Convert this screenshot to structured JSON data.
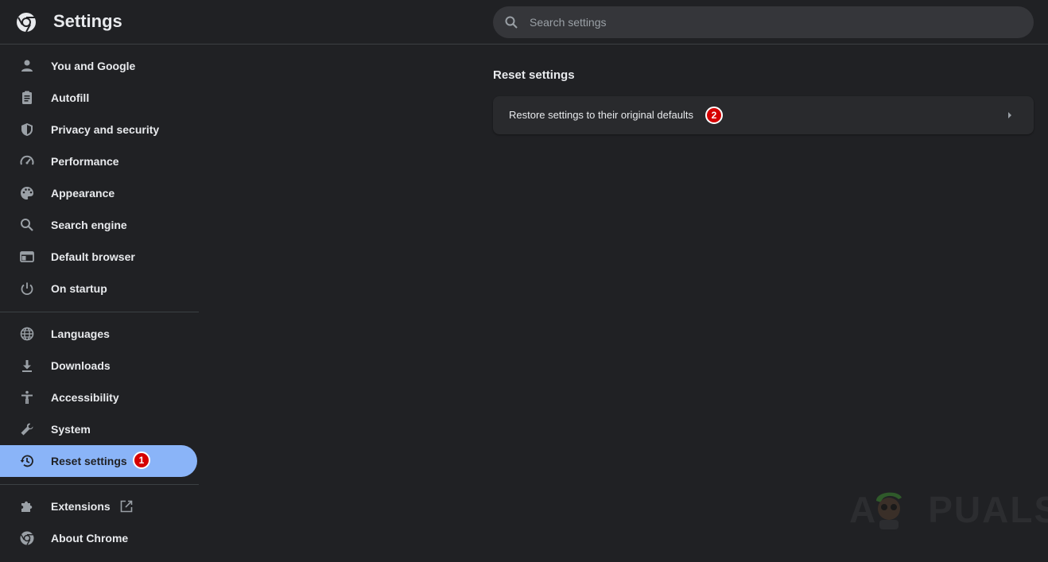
{
  "header": {
    "title": "Settings",
    "search_placeholder": "Search settings"
  },
  "sidebar": {
    "items": [
      {
        "label": "You and Google",
        "icon": "person-icon"
      },
      {
        "label": "Autofill",
        "icon": "clipboard-icon"
      },
      {
        "label": "Privacy and security",
        "icon": "shield-icon"
      },
      {
        "label": "Performance",
        "icon": "speedometer-icon"
      },
      {
        "label": "Appearance",
        "icon": "palette-icon"
      },
      {
        "label": "Search engine",
        "icon": "search-icon"
      },
      {
        "label": "Default browser",
        "icon": "browser-window-icon"
      },
      {
        "label": "On startup",
        "icon": "power-icon"
      },
      {
        "label": "Languages",
        "icon": "globe-icon"
      },
      {
        "label": "Downloads",
        "icon": "download-icon"
      },
      {
        "label": "Accessibility",
        "icon": "accessibility-icon"
      },
      {
        "label": "System",
        "icon": "wrench-icon"
      },
      {
        "label": "Reset settings",
        "icon": "history-icon",
        "active": true
      },
      {
        "label": "Extensions",
        "icon": "puzzle-icon"
      },
      {
        "label": "About Chrome",
        "icon": "chrome-icon"
      }
    ]
  },
  "main": {
    "section_title": "Reset settings",
    "restore_label": "Restore settings to their original defaults"
  },
  "annotations": {
    "badge1": "1",
    "badge2": "2"
  },
  "watermark": {
    "text_a": "A",
    "text_puals": "PUALS"
  },
  "colors": {
    "background": "#202124",
    "accent": "#8ab4f8",
    "card": "#292a2d",
    "badge": "#d50000"
  }
}
